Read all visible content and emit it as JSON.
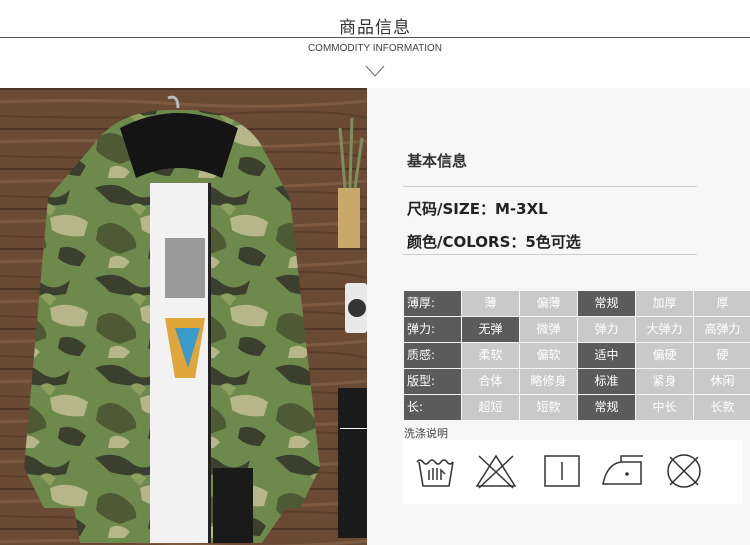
{
  "header": {
    "title": "商品信息",
    "subtitle": "COMMODITY INFORMATION"
  },
  "photo": {
    "description_icon": "camo-jacket-photo",
    "colors": {
      "wood": "#6b4a33",
      "camo_green": "#6d8a4c",
      "camo_dark": "#3b3f2e",
      "camo_tan": "#b6b68a"
    }
  },
  "info": {
    "section_title": "基本信息",
    "size": "尺码/SIZE：M-3XL",
    "colors": "颜色/COLORS：5色可选"
  },
  "attributes": [
    {
      "label": "薄厚:",
      "options": [
        "薄",
        "偏薄",
        "常规",
        "加厚",
        "厚"
      ],
      "selected": 2
    },
    {
      "label": "弹力:",
      "options": [
        "无弹",
        "微弹",
        "弹力",
        "大弹力",
        "高弹力"
      ],
      "selected": 0
    },
    {
      "label": "质感:",
      "options": [
        "柔软",
        "偏软",
        "适中",
        "偏硬",
        "硬"
      ],
      "selected": 2
    },
    {
      "label": "版型:",
      "options": [
        "合体",
        "略修身",
        "标准",
        "紧身",
        "休闲"
      ],
      "selected": 2
    },
    {
      "label": "长:",
      "options": [
        "超短",
        "短款",
        "常规",
        "中长",
        "长款"
      ],
      "selected": 2
    }
  ],
  "care": {
    "title": "洗涤说明",
    "icons": [
      "hand-wash-icon",
      "do-not-bleach-icon",
      "line-dry-icon",
      "iron-low-icon",
      "do-not-dry-clean-icon"
    ]
  },
  "style": {
    "selected_color": "#5b5b5b",
    "unselected_color": "#c9c9c9"
  }
}
